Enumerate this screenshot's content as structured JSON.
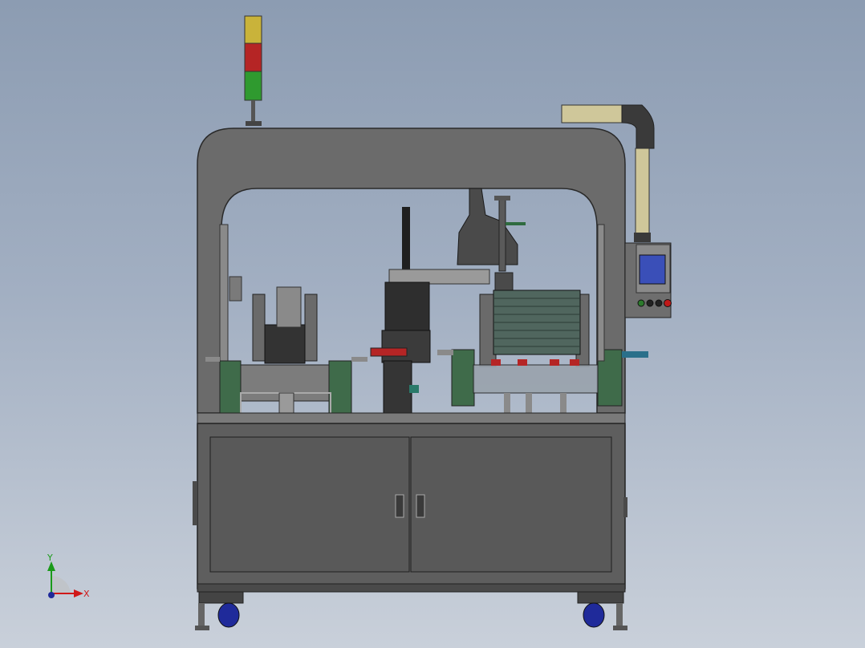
{
  "viewport": {
    "background_top": "#8c9cb2",
    "background_bottom": "#c9d0da"
  },
  "colors": {
    "frame": "#6b6b6b",
    "cabinet": "#595959",
    "panel_green": "#3f6b4a",
    "tower_yellow": "#c9b33a",
    "tower_red": "#b52525",
    "tower_green": "#2f9a2f",
    "duct": "#cfc79a",
    "screen": "#3a4fb8",
    "caster": "#1f2a9a"
  },
  "machine": {
    "signal_tower": [
      "yellow",
      "red",
      "green"
    ],
    "control_panel": {
      "screen_icon": "hmi-screen-icon",
      "buttons": [
        "green",
        "black",
        "black",
        "black",
        "red"
      ]
    }
  },
  "triad": {
    "x_label": "X",
    "y_label": "Y"
  }
}
